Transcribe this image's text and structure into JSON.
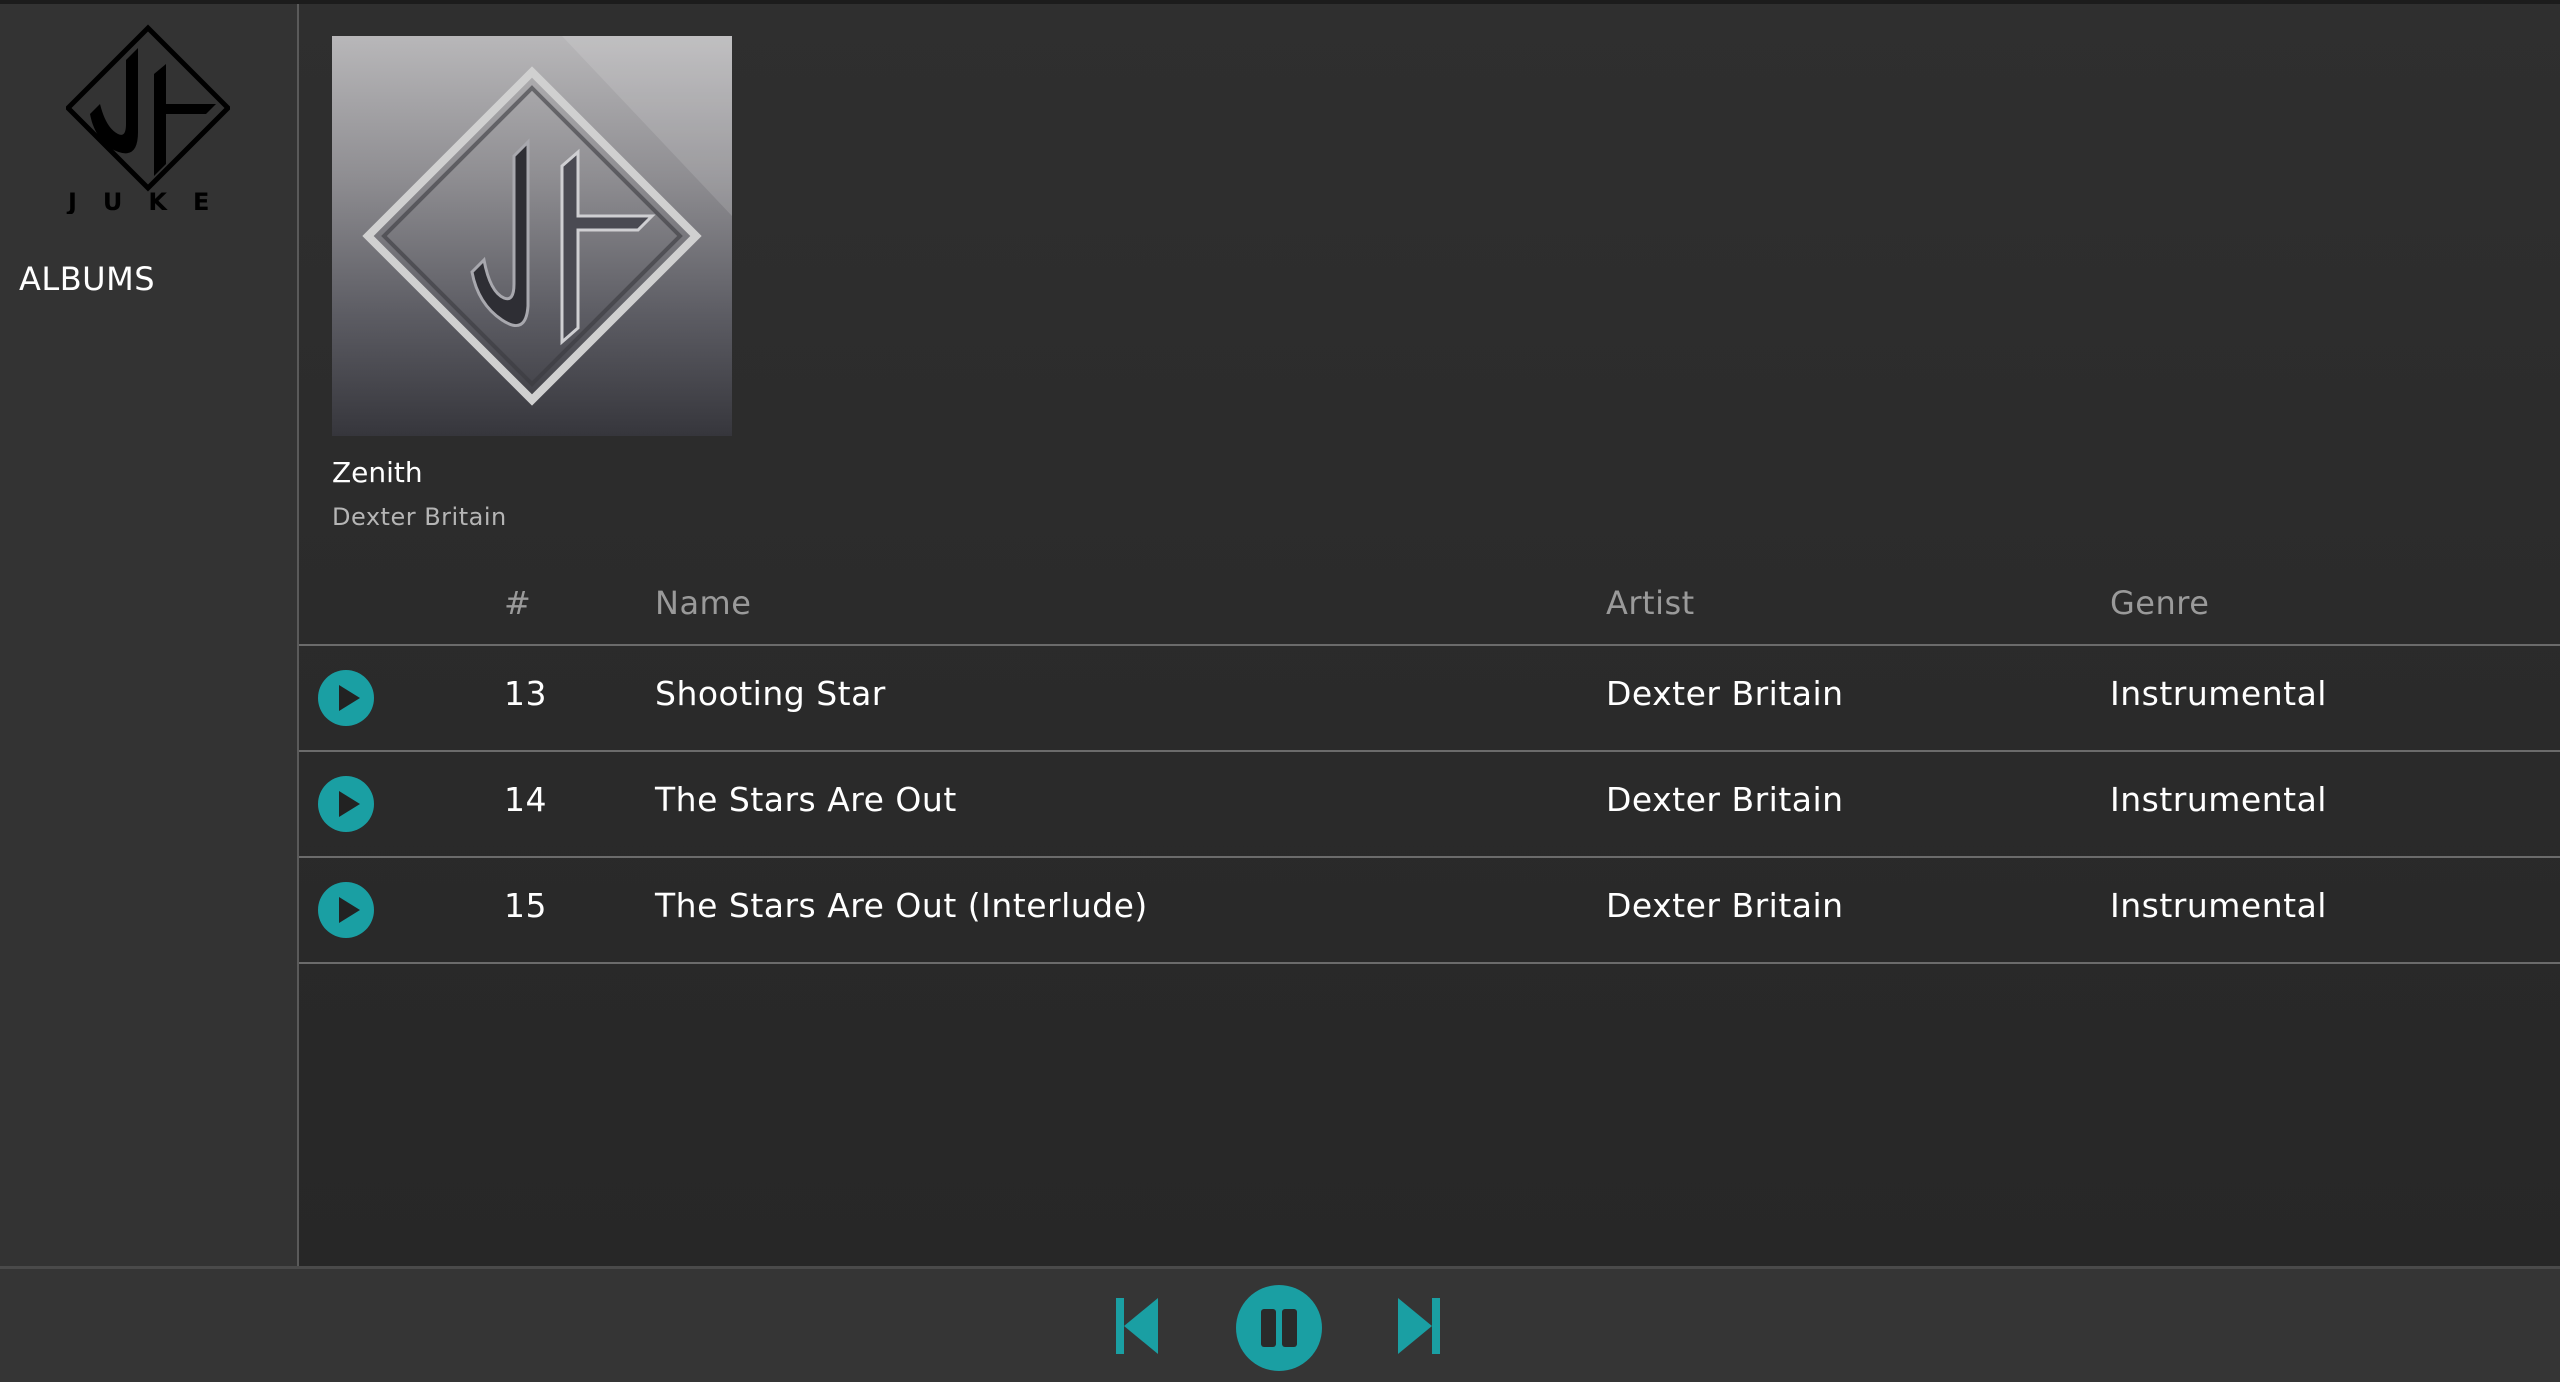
{
  "app": {
    "logo_text": "JUKE"
  },
  "sidebar": {
    "items": [
      {
        "label": "ALBUMS"
      }
    ]
  },
  "album": {
    "title": "Zenith",
    "artist": "Dexter Britain"
  },
  "tracks_table": {
    "headers": {
      "number": "#",
      "name": "Name",
      "artist": "Artist",
      "genre": "Genre"
    },
    "rows": [
      {
        "number": "13",
        "name": "Shooting Star",
        "artist": "Dexter Britain",
        "genre": "Instrumental"
      },
      {
        "number": "14",
        "name": "The Stars Are Out",
        "artist": "Dexter Britain",
        "genre": "Instrumental"
      },
      {
        "number": "15",
        "name": "The Stars Are Out (Interlude)",
        "artist": "Dexter Britain",
        "genre": "Instrumental"
      }
    ]
  },
  "player": {
    "state": "playing",
    "controls": [
      "previous-icon",
      "pause-icon",
      "next-icon"
    ]
  },
  "colors": {
    "accent": "#1a9fa3",
    "background": "#2e2e2e",
    "sidebar": "#333333",
    "divider": "#6b6b6b"
  }
}
